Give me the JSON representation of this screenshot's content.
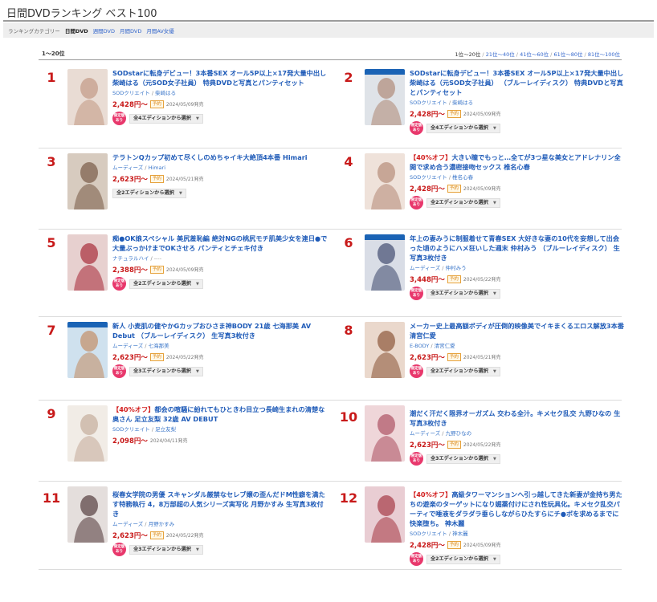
{
  "page": {
    "title": "日間DVDランキング ベスト100"
  },
  "categories": {
    "label": "ランキングカテゴリー",
    "items": [
      {
        "label": "日間DVD",
        "active": true
      },
      {
        "label": "週間DVD",
        "active": false
      },
      {
        "label": "月間DVD",
        "active": false
      },
      {
        "label": "月間AV女優",
        "active": false
      }
    ]
  },
  "range": {
    "current": "1〜20位",
    "nav": [
      "1位〜20位",
      "21位〜40位",
      "41位〜60位",
      "61位〜80位",
      "81位〜100位"
    ]
  },
  "labels": {
    "reserve": "予約",
    "limited": [
      "限定版",
      "あり"
    ],
    "price_suffix": "〜",
    "sep": " / "
  },
  "items": [
    {
      "rank": "1",
      "offer": "",
      "title": "SODstarに転身デビュー！3本番SEX オール5P以上×17発大量中出し 柴崎はる（元SOD女子社員） 特典DVDと写真とパンティセット",
      "maker": "SODクリエイト",
      "actress": "柴崎はる",
      "price": "2,428円",
      "reserve": true,
      "date": "2024/05/09発売",
      "limited": true,
      "editions": "全4エディションから選択",
      "bluray": false
    },
    {
      "rank": "2",
      "offer": "",
      "title": "SODstarに転身デビュー！3本番SEX オール5P以上×17発大量中出し 柴崎はる（元SOD女子社員） （ブルーレイディスク） 特典DVDと写真とパンティセット",
      "maker": "SODクリエイト",
      "actress": "柴崎はる",
      "price": "2,428円",
      "reserve": true,
      "date": "2024/05/09発売",
      "limited": true,
      "editions": "全4エディションから選択",
      "bluray": true
    },
    {
      "rank": "3",
      "offer": "",
      "title": "テラトンQカップ初めて尽くしのめちゃイキ大絶頂4本番 Himari",
      "maker": "ムーディーズ",
      "actress": "Himari",
      "price": "2,623円",
      "reserve": true,
      "date": "2024/05/21発売",
      "limited": false,
      "editions": "全2エディションから選択",
      "bluray": false
    },
    {
      "rank": "4",
      "offer": "【40%オフ】",
      "title": "大きい瞳でもっと…全てが3つ星な美女とアドレナリン全開で求め合う濃密接吻セックス 椎名心春",
      "maker": "SODクリエイト",
      "actress": "椎名心春",
      "price": "2,428円",
      "reserve": true,
      "date": "2024/05/09発売",
      "limited": true,
      "editions": "全2エディションから選択",
      "bluray": false
    },
    {
      "rank": "5",
      "offer": "",
      "title": "痴●OK娘スペシャル 美尻羞恥編 絶対NGの桃尻モチ肌美少女を連日●で大量ぶっかけまでOKさせろ パンティとチェキ付き",
      "maker": "ナチュラルハイ",
      "actress": "----",
      "price": "2,388円",
      "reserve": true,
      "date": "2024/05/09発売",
      "limited": true,
      "editions": "全2エディションから選択",
      "bluray": false
    },
    {
      "rank": "6",
      "offer": "",
      "title": "年上の妻みうに制服着せて青春SEX 大好きな妻の10代を妄想して出会った頃のようにハメ狂いした週末 仲村みう （ブルーレイディスク） 生写真3枚付き",
      "maker": "ムーディーズ",
      "actress": "仲村みう",
      "price": "3,448円",
      "reserve": true,
      "date": "2024/05/22発売",
      "limited": true,
      "editions": "全3エディションから選択",
      "bluray": true
    },
    {
      "rank": "7",
      "offer": "",
      "title": "新人 小麦肌の健やかGカップおひさま神BODY 21歳 七海那美 AV Debut （ブルーレイディスク） 生写真3枚付き",
      "maker": "ムーディーズ",
      "actress": "七海那美",
      "price": "2,623円",
      "reserve": true,
      "date": "2024/05/22発売",
      "limited": true,
      "editions": "全3エディションから選択",
      "bluray": true
    },
    {
      "rank": "8",
      "offer": "",
      "title": "メーカー史上最高額ボディが圧倒的映像美でイキまくるエロス解放3本番 清宮仁愛",
      "maker": "E-BODY",
      "actress": "清宮仁愛",
      "price": "2,623円",
      "reserve": true,
      "date": "2024/05/21発売",
      "limited": true,
      "editions": "全2エディションから選択",
      "bluray": false
    },
    {
      "rank": "9",
      "offer": "【40%オフ】",
      "title": "都会の喧騒に紛れてもひときわ目立つ長崎生まれの清楚な奥さん 足立友梨 32歳 AV DEBUT",
      "maker": "SODクリエイト",
      "actress": "足立友梨",
      "price": "2,098円",
      "reserve": false,
      "date": "2024/04/11発売",
      "limited": false,
      "editions": "",
      "bluray": false
    },
    {
      "rank": "10",
      "offer": "",
      "title": "潮だく汗だく限界オーガズム 交わる全汁。キメセク乱交 九野ひなの 生写真3枚付き",
      "maker": "ムーディーズ",
      "actress": "九野ひなの",
      "price": "2,623円",
      "reserve": true,
      "date": "2024/05/22発売",
      "limited": true,
      "editions": "全3エディションから選択",
      "bluray": false
    },
    {
      "rank": "11",
      "offer": "",
      "title": "桜春女学院の男優 スキャンダル厳禁なセレブ嬢の歪んだドM性癖を満たす特務執行 4，8万部超の人気シリーズ実写化 月野かすみ 生写真3枚付き",
      "maker": "ムーディーズ",
      "actress": "月野かすみ",
      "price": "2,623円",
      "reserve": true,
      "date": "2024/05/22発売",
      "limited": true,
      "editions": "全3エディションから選択",
      "bluray": false
    },
    {
      "rank": "12",
      "offer": "【40%オフ】",
      "title": "高級タワーマンションへ引っ越してきた新妻が金持ち男たちの遊楽のターゲットになり媚薬付けにされ性玩具化。キメセク乱交パーティで唾液をダラダラ垂らしながらひたすらにチ●ポを求めるまでに快楽堕ち。 神木麗",
      "maker": "SODクリエイト",
      "actress": "神木麗",
      "price": "2,428円",
      "reserve": true,
      "date": "2024/05/09発売",
      "limited": true,
      "editions": "全2エディションから選択",
      "bluray": false
    }
  ]
}
